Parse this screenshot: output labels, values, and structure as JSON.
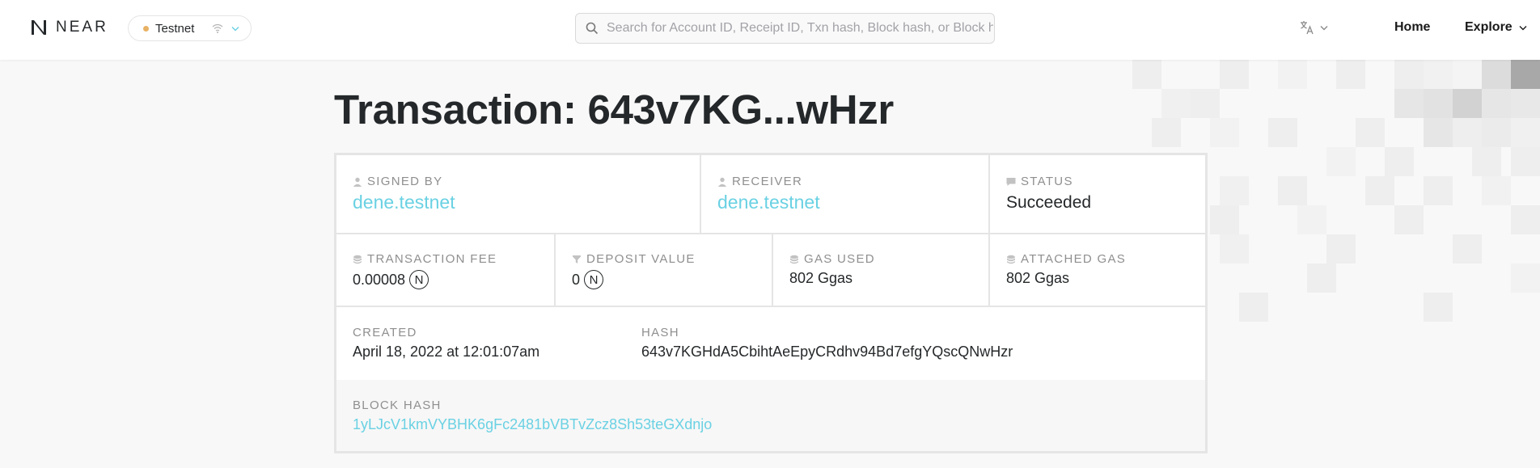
{
  "header": {
    "logo_text": "NEAR",
    "network": {
      "label": "Testnet",
      "dot_color": "#e8b164"
    },
    "search": {
      "placeholder": "Search for Account ID, Receipt ID, Txn hash, Block hash, or Block height"
    },
    "nav": {
      "home": "Home",
      "explore": "Explore"
    },
    "icons": [
      "near-logo-icon",
      "wifi-icon",
      "chevron-down-icon",
      "search-icon",
      "translate-icon"
    ]
  },
  "page": {
    "title": "Transaction: 643v7KG...wHzr"
  },
  "details": {
    "signed_by": {
      "label": "SIGNED BY",
      "value": "dene.testnet"
    },
    "receiver": {
      "label": "RECEIVER",
      "value": "dene.testnet"
    },
    "status": {
      "label": "STATUS",
      "value": "Succeeded"
    },
    "transaction_fee": {
      "label": "TRANSACTION FEE",
      "value": "0.00008",
      "unit": "N"
    },
    "deposit_value": {
      "label": "DEPOSIT VALUE",
      "value": "0",
      "unit": "N"
    },
    "gas_used": {
      "label": "GAS USED",
      "value": "802 Ggas"
    },
    "attached_gas": {
      "label": "ATTACHED GAS",
      "value": "802 Ggas"
    },
    "created": {
      "label": "CREATED",
      "value": "April 18, 2022 at 12:01:07am"
    },
    "hash": {
      "label": "HASH",
      "value": "643v7KGHdA5CbihtAeEpyCRdhv94Bd7efgYQscQNwHzr"
    },
    "block_hash": {
      "label": "BLOCK HASH",
      "value": "1yLJcV1kmVYBHK6gFc2481bVBTvZcz8Sh53teGXdnjo"
    }
  },
  "colors": {
    "link": "#6ad1e3",
    "text": "#25282a",
    "label": "#8f8f8f",
    "border": "#e5e5e5"
  }
}
